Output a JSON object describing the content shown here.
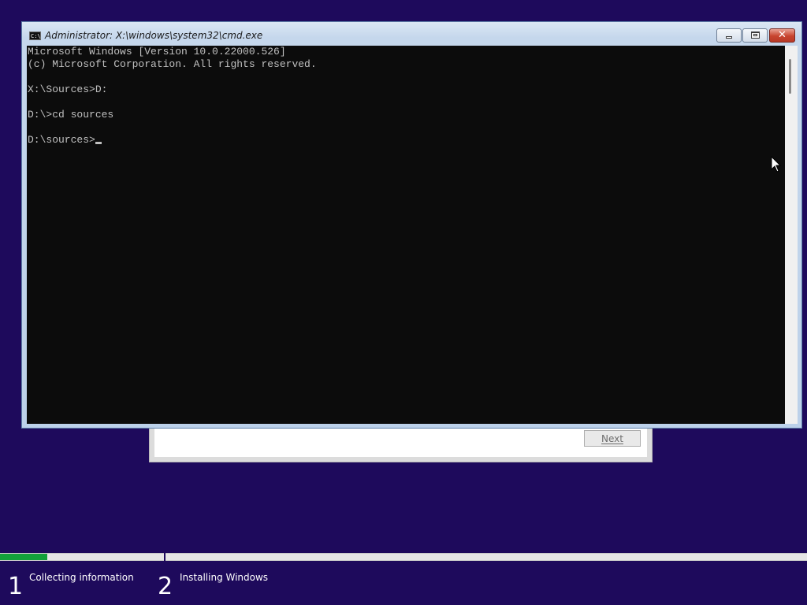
{
  "cmd_window": {
    "title": "Administrator: X:\\windows\\system32\\cmd.exe",
    "icon_text": "C:\\",
    "controls": {
      "minimize": "minimize-icon",
      "maximize": "maximize-icon",
      "close": "✕"
    },
    "console": {
      "lines": [
        "Microsoft Windows [Version 10.0.22000.526]",
        "(c) Microsoft Corporation. All rights reserved.",
        "",
        "X:\\Sources>D:",
        "",
        "D:\\>cd sources",
        "",
        "D:\\sources>"
      ]
    }
  },
  "setup_dialog": {
    "next_label": "Next"
  },
  "progress": {
    "collecting_fraction": 0.29,
    "steps": [
      {
        "number": "1",
        "label": "Collecting information"
      },
      {
        "number": "2",
        "label": "Installing Windows"
      }
    ]
  },
  "colors": {
    "background": "#1e0a5c",
    "progress_fill": "#12a03a",
    "console_bg": "#0c0c0c",
    "console_text": "#c0c0c0"
  }
}
